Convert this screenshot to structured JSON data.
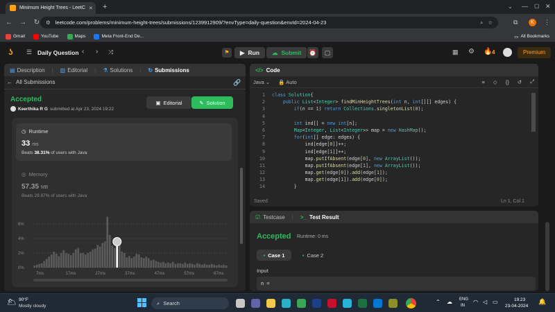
{
  "browser": {
    "tab_title": "Minimum Height Trees - LeetC",
    "url": "leetcode.com/problems/minimum-height-trees/submissions/1239912909/?envType=daily-question&envId=2024-04-23",
    "bookmarks": [
      {
        "label": "Gmail",
        "color": "#ea4335"
      },
      {
        "label": "YouTube",
        "color": "#ff0000"
      },
      {
        "label": "Maps",
        "color": "#34a853"
      },
      {
        "label": "Meta Front-End De...",
        "color": "#1877f2"
      }
    ],
    "all_bookmarks": "All Bookmarks",
    "profile_initial": "K"
  },
  "leetcode": {
    "daily_question": "Daily Question",
    "run": "Run",
    "submit": "Submit",
    "streak": "4",
    "premium": "Premium"
  },
  "left": {
    "tabs": [
      "Description",
      "Editorial",
      "Solutions",
      "Submissions"
    ],
    "all_submissions": "All Submissions",
    "status": "Accepted",
    "user": "Keerthika R G",
    "submitted_at": "submitted at Apr 23, 2024 19:22",
    "editorial_btn": "Editorial",
    "solution_btn": "Solution",
    "runtime_label": "Runtime",
    "runtime_value": "33",
    "runtime_unit": "ms",
    "runtime_beats_pre": "Beats",
    "runtime_beats": "38.31%",
    "runtime_beats_post": "of users with Java",
    "memory_label": "Memory",
    "memory_value": "57.35",
    "memory_unit": "MB",
    "memory_beats_pre": "Beats",
    "memory_beats": "29.87%",
    "memory_beats_post": "of users with Java"
  },
  "chart_data": {
    "type": "bar",
    "yticks": [
      "6%",
      "4%",
      "2%",
      "0%"
    ],
    "ylim": [
      0,
      8
    ],
    "xticks": [
      "7ms",
      "17ms",
      "27ms",
      "37ms",
      "47ms",
      "57ms",
      "67ms"
    ],
    "values": [
      0.3,
      0.4,
      0.5,
      0.6,
      0.9,
      1.2,
      1.5,
      1.8,
      2.2,
      1.9,
      1.6,
      2.0,
      2.4,
      2.0,
      1.9,
      1.7,
      2.0,
      2.5,
      2.7,
      2.0,
      2.0,
      1.8,
      2.0,
      2.2,
      2.5,
      2.6,
      3.1,
      2.9,
      3.4,
      3.6,
      7.0,
      4.5,
      3.0,
      2.7,
      3.0,
      3.4,
      2.2,
      2.0,
      1.4,
      1.6,
      1.3,
      1.5,
      1.9,
      1.8,
      1.4,
      1.3,
      1.5,
      1.3,
      1.0,
      1.1,
      0.9,
      0.8,
      0.7,
      0.8,
      0.6,
      0.7,
      0.6,
      0.8,
      0.5,
      0.6,
      0.6,
      0.5,
      0.7,
      0.5,
      0.6,
      0.5,
      0.4,
      0.6,
      0.5,
      0.4,
      0.5,
      0.4,
      0.4,
      0.5,
      0.4,
      0.3,
      0.4,
      0.3,
      0.4,
      0.3
    ],
    "highlight_index": 34
  },
  "code": {
    "title": "Code",
    "lang": "Java",
    "mode": "Auto",
    "lines": [
      [
        [
          "kw",
          "class "
        ],
        [
          "ty",
          "Solution"
        ],
        [
          "",
          "{"
        ]
      ],
      [
        [
          "",
          "    "
        ],
        [
          "kw",
          "public "
        ],
        [
          "ty",
          "List"
        ],
        [
          "",
          "<"
        ],
        [
          "ty",
          "Integer"
        ],
        [
          "",
          "> "
        ],
        [
          "fn",
          "findMinHeightTrees"
        ],
        [
          "",
          "("
        ],
        [
          "kw",
          "int "
        ],
        [
          "",
          "n, "
        ],
        [
          "kw",
          "int"
        ],
        [
          "",
          "[][] edges) {"
        ]
      ],
      [
        [
          "",
          "        "
        ],
        [
          "kw",
          "if"
        ],
        [
          "",
          "(n == "
        ],
        [
          "nm",
          "1"
        ],
        [
          "",
          ") "
        ],
        [
          "kw",
          "return "
        ],
        [
          "ty",
          "Collections"
        ],
        [
          ".",
          ""
        ],
        [
          "fn",
          "singletonList"
        ],
        [
          "",
          "("
        ],
        [
          "nm",
          "0"
        ],
        [
          "",
          ");"
        ]
      ],
      [
        [
          "",
          ""
        ]
      ],
      [
        [
          "",
          "        "
        ],
        [
          "kw",
          "int "
        ],
        [
          "",
          "ind[] = "
        ],
        [
          "kw",
          "new int"
        ],
        [
          "",
          "[n];"
        ]
      ],
      [
        [
          "",
          "        "
        ],
        [
          "ty",
          "Map"
        ],
        [
          "",
          "<"
        ],
        [
          "ty",
          "Integer"
        ],
        [
          "",
          ", "
        ],
        [
          "ty",
          "List"
        ],
        [
          "",
          "<"
        ],
        [
          "ty",
          "Integer"
        ],
        [
          "",
          ">> map = "
        ],
        [
          "kw",
          "new "
        ],
        [
          "ty",
          "HashMap"
        ],
        [
          "",
          "();"
        ]
      ],
      [
        [
          "",
          "        "
        ],
        [
          "kw",
          "for"
        ],
        [
          "",
          "("
        ],
        [
          "kw",
          "int"
        ],
        [
          "",
          "[] edge: edges) {"
        ]
      ],
      [
        [
          "",
          "            ind[edge["
        ],
        [
          "nm",
          "0"
        ],
        [
          "",
          "]]++;"
        ]
      ],
      [
        [
          "",
          "            ind[edge["
        ],
        [
          "nm",
          "1"
        ],
        [
          "",
          "]]++;"
        ]
      ],
      [
        [
          "",
          "            map."
        ],
        [
          "fn",
          "putIfAbsent"
        ],
        [
          "",
          "(edge["
        ],
        [
          "nm",
          "0"
        ],
        [
          "",
          "], "
        ],
        [
          "kw",
          "new "
        ],
        [
          "ty",
          "ArrayList"
        ],
        [
          "",
          "());"
        ]
      ],
      [
        [
          "",
          "            map."
        ],
        [
          "fn",
          "putIfAbsent"
        ],
        [
          "",
          "(edge["
        ],
        [
          "nm",
          "1"
        ],
        [
          "",
          "], "
        ],
        [
          "kw",
          "new "
        ],
        [
          "ty",
          "ArrayList"
        ],
        [
          "",
          "());"
        ]
      ],
      [
        [
          "",
          "            map."
        ],
        [
          "fn",
          "get"
        ],
        [
          "",
          "(edge["
        ],
        [
          "nm",
          "0"
        ],
        [
          "",
          "])."
        ],
        [
          "fn",
          "add"
        ],
        [
          "",
          "(edge["
        ],
        [
          "nm",
          "1"
        ],
        [
          "",
          "]);"
        ]
      ],
      [
        [
          "",
          "            map."
        ],
        [
          "fn",
          "get"
        ],
        [
          "",
          "(edge["
        ],
        [
          "nm",
          "1"
        ],
        [
          "",
          "])."
        ],
        [
          "fn",
          "add"
        ],
        [
          "",
          "(edge["
        ],
        [
          "nm",
          "0"
        ],
        [
          "",
          "]);"
        ]
      ],
      [
        [
          "",
          "        }"
        ]
      ]
    ],
    "saved": "Saved",
    "position": "Ln 1, Col 1"
  },
  "result": {
    "tab_testcase": "Testcase",
    "tab_result": "Test Result",
    "status": "Accepted",
    "runtime": "Runtime: 0 ms",
    "case1": "Case 1",
    "case2": "Case 2",
    "input_label": "Input",
    "input_value": "n ="
  },
  "taskbar": {
    "temp": "90°F",
    "weather": "Mostly cloudy",
    "search": "Search",
    "lang1": "ENG",
    "lang2": "IN",
    "time": "19:23",
    "date": "23-04-2024"
  }
}
